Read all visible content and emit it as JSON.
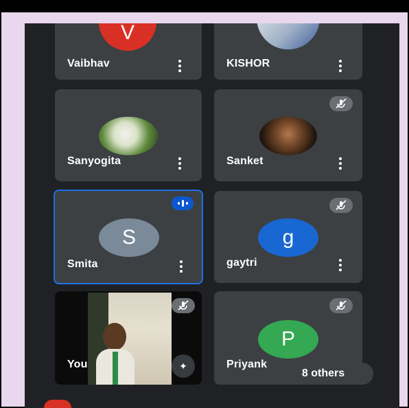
{
  "participants": [
    {
      "name": "Vaibhav",
      "initial": "V",
      "avatar_color": "#d93025"
    },
    {
      "name": "KISHOR"
    },
    {
      "name": "Sanyogita"
    },
    {
      "name": "Sanket"
    },
    {
      "name": "Smita",
      "initial": "S",
      "avatar_color": "#7b8a99"
    },
    {
      "name": "gaytri",
      "initial": "g",
      "avatar_color": "#1967d2"
    },
    {
      "name": "You"
    },
    {
      "name": "Priyank",
      "initial": "P",
      "avatar_color": "#34a853"
    }
  ],
  "others_label": "8 others",
  "icons": {
    "more": "more-vert-icon",
    "mic_off": "mic-off-icon",
    "speaking": "speaking-indicator-icon",
    "effects": "sparkle-effects-icon"
  }
}
